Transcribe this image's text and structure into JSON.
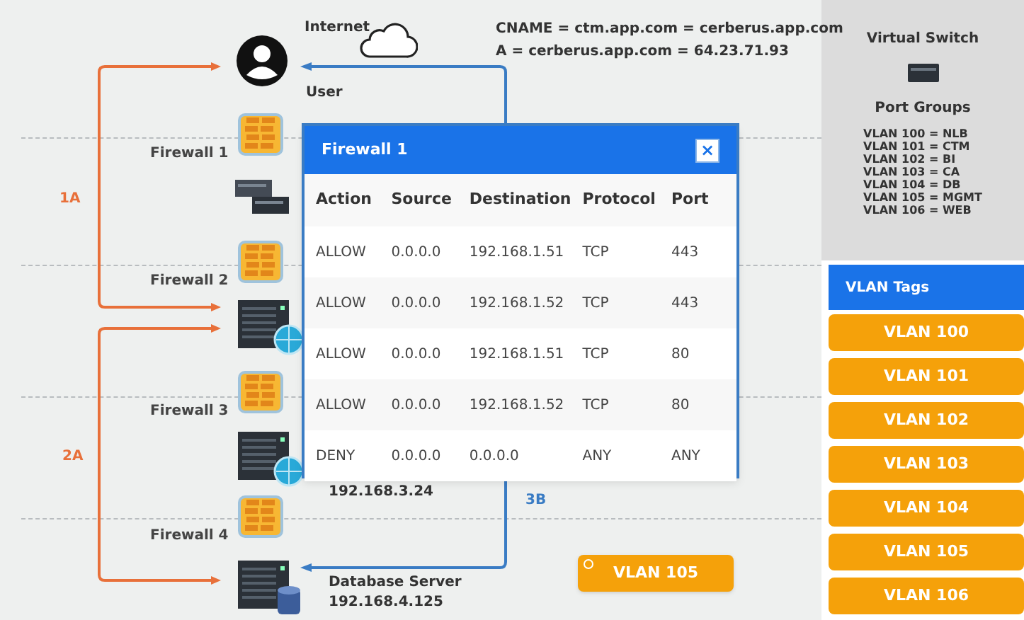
{
  "diagram": {
    "internet_label": "Internet",
    "dns_records": [
      "CNAME = ctm.app.com = cerberus.app.com",
      "A = cerberus.app.com = 64.23.71.93"
    ],
    "user_label": "User",
    "firewalls": [
      "Firewall 1",
      "Firewall 2",
      "Firewall 3",
      "Firewall 4"
    ],
    "path_labels": [
      {
        "text": "1A",
        "color": "#e8703a"
      },
      {
        "text": "2A",
        "color": "#e8703a"
      },
      {
        "text": "3B",
        "color": "#3a7cc4"
      }
    ],
    "bi_server_ip": "192.168.3.24",
    "database_server": {
      "name": "Database Server",
      "ip": "192.168.4.125"
    },
    "placed_tag": "VLAN 105"
  },
  "dialog": {
    "title": "Firewall 1",
    "close": "×",
    "columns": [
      "Action",
      "Source",
      "Destination",
      "Protocol",
      "Port"
    ],
    "rows": [
      [
        "ALLOW",
        "0.0.0.0",
        "192.168.1.51",
        "TCP",
        "443"
      ],
      [
        "ALLOW",
        "0.0.0.0",
        "192.168.1.52",
        "TCP",
        "443"
      ],
      [
        "ALLOW",
        "0.0.0.0",
        "192.168.1.51",
        "TCP",
        "80"
      ],
      [
        "ALLOW",
        "0.0.0.0",
        "192.168.1.52",
        "TCP",
        "80"
      ],
      [
        "DENY",
        "0.0.0.0",
        "0.0.0.0",
        "ANY",
        "ANY"
      ]
    ]
  },
  "virtual_switch": {
    "title": "Virtual Switch",
    "port_groups_title": "Port Groups",
    "port_groups": [
      "VLAN 100 = NLB",
      "VLAN 101 = CTM",
      "VLAN 102 = BI",
      "VLAN 103 = CA",
      "VLAN 104 = DB",
      "VLAN 105 = MGMT",
      "VLAN 106 = WEB"
    ]
  },
  "vlan_tags": {
    "title": "VLAN Tags",
    "tags": [
      "VLAN 100",
      "VLAN 101",
      "VLAN 102",
      "VLAN 103",
      "VLAN 104",
      "VLAN 105",
      "VLAN 106"
    ]
  }
}
